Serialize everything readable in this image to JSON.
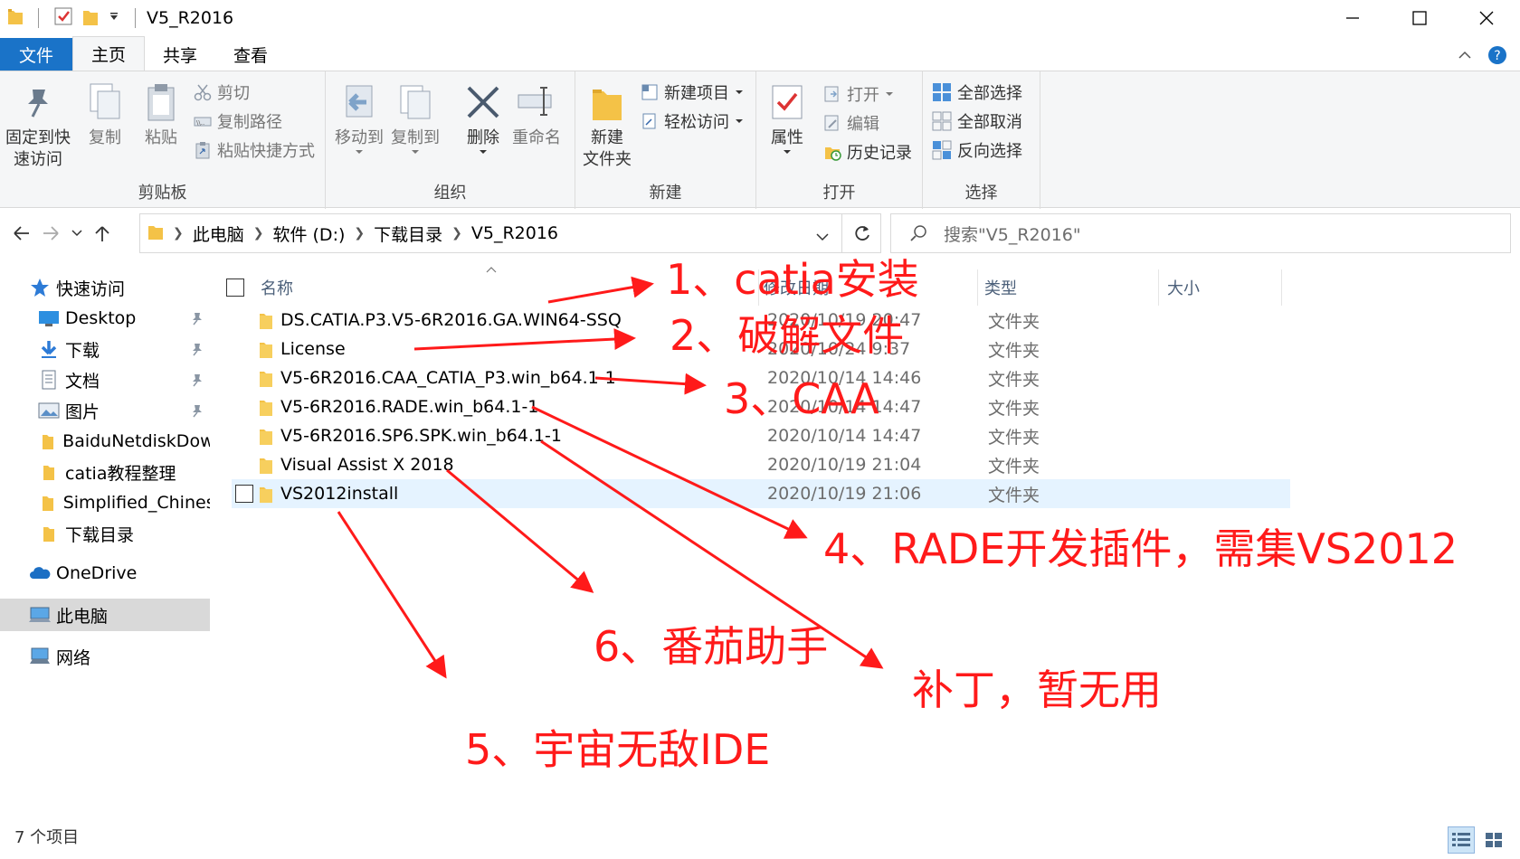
{
  "window": {
    "title": "V5_R2016",
    "controls": [
      "minimize",
      "maximize",
      "close"
    ]
  },
  "tabs": [
    {
      "label": "文件"
    },
    {
      "label": "主页"
    },
    {
      "label": "共享"
    },
    {
      "label": "查看"
    }
  ],
  "ribbon": {
    "clipboard": {
      "label": "剪贴板",
      "pin": "固定到快\n速访问",
      "pin_l1": "固定到快",
      "pin_l2": "速访问",
      "copy": "复制",
      "paste": "粘贴",
      "cut": "剪切",
      "copy_path": "复制路径",
      "paste_shortcut": "粘贴快捷方式"
    },
    "organize": {
      "label": "组织",
      "move_to": "移动到",
      "copy_to": "复制到",
      "delete": "删除",
      "rename": "重命名"
    },
    "new": {
      "label": "新建",
      "new_folder_l1": "新建",
      "new_folder_l2": "文件夹",
      "new_item": "新建项目",
      "easy_access": "轻松访问"
    },
    "open": {
      "label": "打开",
      "properties": "属性",
      "open": "打开",
      "edit": "编辑",
      "history": "历史记录"
    },
    "select": {
      "label": "选择",
      "select_all": "全部选择",
      "select_none": "全部取消",
      "invert": "反向选择"
    }
  },
  "address": {
    "crumbs": [
      "此电脑",
      "软件 (D:)",
      "下载目录",
      "V5_R2016"
    ],
    "search_placeholder": "搜索\"V5_R2016\""
  },
  "sidebar": {
    "items": [
      {
        "label": "快速访问",
        "icon": "star-icon"
      },
      {
        "label": "Desktop",
        "icon": "desktop-icon",
        "pinned": true
      },
      {
        "label": "下载",
        "icon": "download-icon",
        "pinned": true
      },
      {
        "label": "文档",
        "icon": "document-icon",
        "pinned": true
      },
      {
        "label": "图片",
        "icon": "picture-icon",
        "pinned": true
      },
      {
        "label": "BaiduNetdiskDownl",
        "icon": "folder-icon"
      },
      {
        "label": "catia教程整理",
        "icon": "folder-icon"
      },
      {
        "label": "Simplified_Chinese",
        "icon": "folder-icon"
      },
      {
        "label": "下载目录",
        "icon": "folder-icon"
      },
      {
        "label": "OneDrive",
        "icon": "cloud-icon"
      },
      {
        "label": "此电脑",
        "icon": "computer-icon",
        "selected": true
      },
      {
        "label": "网络",
        "icon": "network-icon"
      }
    ]
  },
  "columns": {
    "name": "名称",
    "date": "修改日期",
    "type": "类型",
    "size": "大小"
  },
  "files": [
    {
      "name": "DS.CATIA.P3.V5-6R2016.GA.WIN64-SSQ",
      "date": "2020/10/19 20:47",
      "type": "文件夹"
    },
    {
      "name": "License",
      "date": "2020/10/24 9:37",
      "type": "文件夹"
    },
    {
      "name": "V5-6R2016.CAA_CATIA_P3.win_b64.1-1",
      "date": "2020/10/14 14:46",
      "type": "文件夹"
    },
    {
      "name": "V5-6R2016.RADE.win_b64.1-1",
      "date": "2020/10/14 14:47",
      "type": "文件夹"
    },
    {
      "name": "V5-6R2016.SP6.SPK.win_b64.1-1",
      "date": "2020/10/14 14:47",
      "type": "文件夹"
    },
    {
      "name": "Visual Assist X 2018",
      "date": "2020/10/19 21:04",
      "type": "文件夹"
    },
    {
      "name": "VS2012install",
      "date": "2020/10/19 21:06",
      "type": "文件夹",
      "hover": true
    }
  ],
  "status": {
    "count": "7 个项目"
  },
  "annotations": [
    {
      "text": "1、catia安装"
    },
    {
      "text": "2、破解文件"
    },
    {
      "text": "3、CAA"
    },
    {
      "text": "4、RADE开发插件，需集VS2012"
    },
    {
      "text": "6、番茄助手"
    },
    {
      "text": "补丁，暂无用"
    },
    {
      "text": "5、宇宙无敌IDE"
    }
  ],
  "colors": {
    "accent": "#1a73c8",
    "annotation": "#ff1a1a",
    "folder": "#f4c247",
    "selected_row": "#e5f3ff"
  }
}
